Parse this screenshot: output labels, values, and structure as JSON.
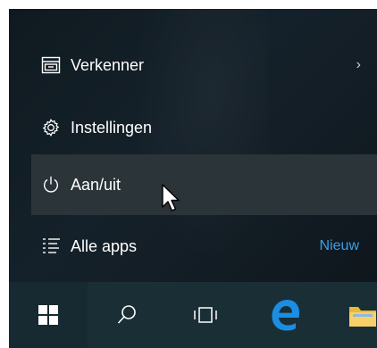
{
  "menu": {
    "items": [
      {
        "name": "explorer",
        "label": "Verkenner",
        "icon": "file-explorer-icon",
        "trailing": "›"
      },
      {
        "name": "settings",
        "label": "Instellingen",
        "icon": "gear-icon"
      },
      {
        "name": "power",
        "label": "Aan/uit",
        "icon": "power-icon",
        "highlighted": true
      },
      {
        "name": "all-apps",
        "label": "Alle apps",
        "icon": "list-icon",
        "badge": "Nieuw"
      }
    ]
  },
  "taskbar": {
    "buttons": [
      {
        "name": "start",
        "icon": "windows-logo-icon"
      },
      {
        "name": "search",
        "icon": "search-icon"
      },
      {
        "name": "task-view",
        "icon": "task-view-icon"
      },
      {
        "name": "edge",
        "icon": "edge-browser-icon"
      },
      {
        "name": "file-explorer",
        "icon": "folder-icon"
      }
    ]
  },
  "colors": {
    "menu_background": "#15212a",
    "hover_highlight": "#2b3439",
    "taskbar_background": "#1a2e35",
    "accent": "#3aa0e6",
    "text": "#ffffff"
  }
}
